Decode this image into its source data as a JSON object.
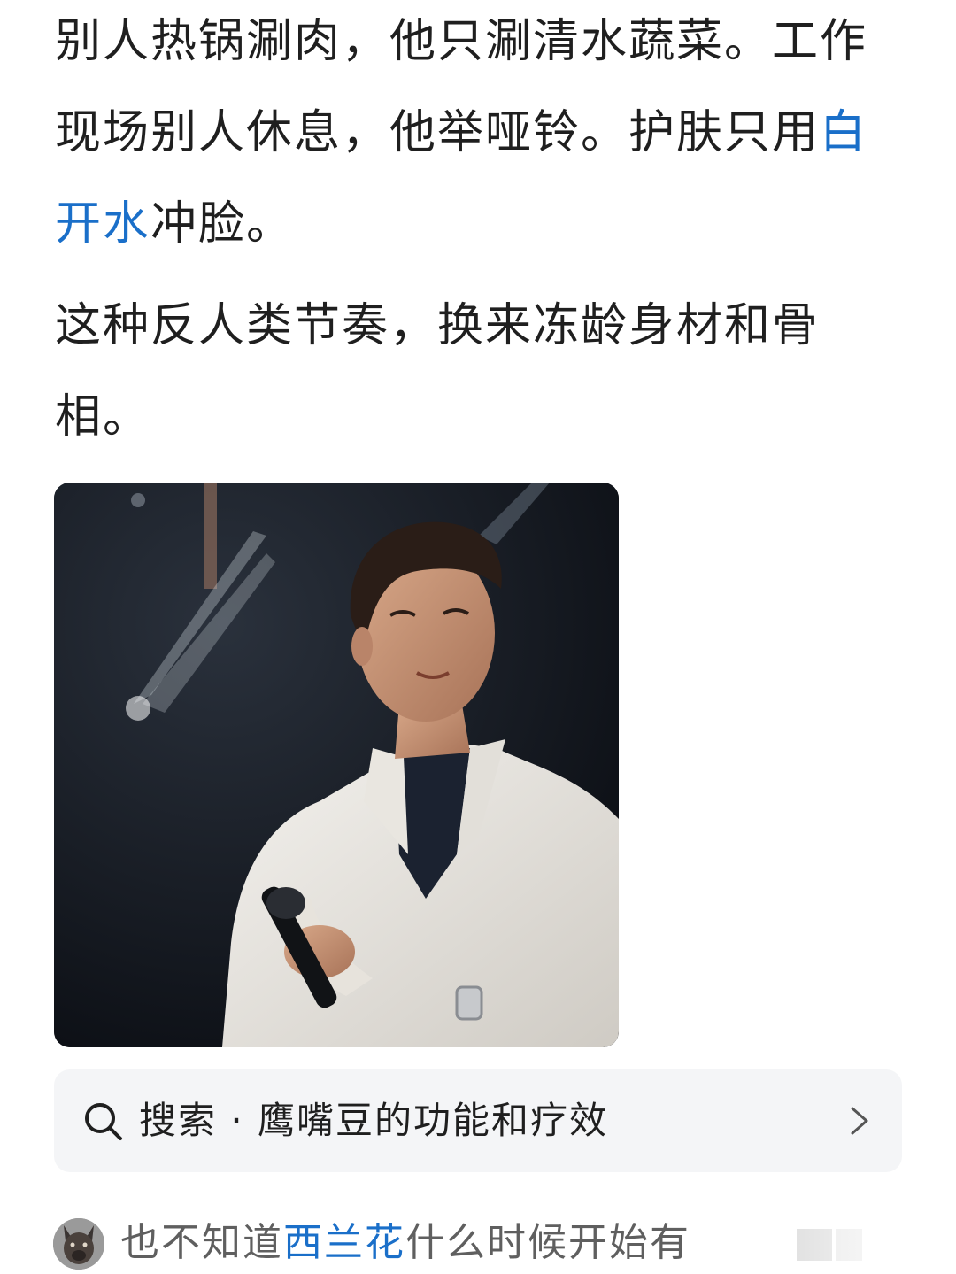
{
  "article": {
    "p1_text1": "别人热锅涮肉，他只涮清水蔬菜。工作现场别人休息，他举哑铃。护肤只用",
    "p1_link": "白开水",
    "p1_text2": "冲脸。",
    "p2": "这种反人类节奏，换来冻龄身材和骨相。"
  },
  "photo": {
    "icon": "concert-photo"
  },
  "search": {
    "label": "搜索 · 鹰嘴豆的功能和疗效",
    "icon": "search-icon",
    "chevron": "chevron-right-icon"
  },
  "comment": {
    "text1": "也不知道",
    "link": "西兰花",
    "text2": "什么时候开始有",
    "avatar": "dog-avatar"
  },
  "colors": {
    "link": "#1a6fc9",
    "text": "#1f1f1f",
    "muted": "#5f5f5f",
    "card_bg": "#f4f5f7"
  }
}
